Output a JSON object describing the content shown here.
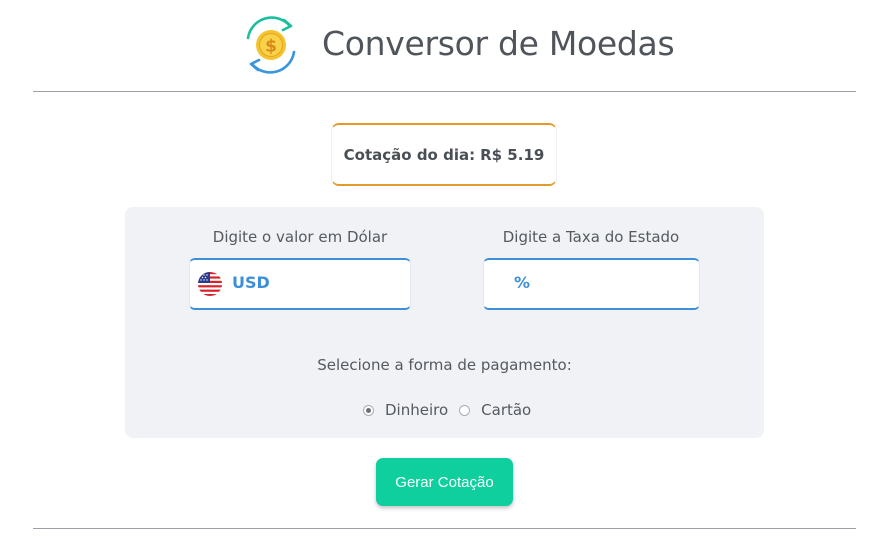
{
  "header": {
    "title": "Conversor de Moedas",
    "logo_icon": "dollar-coin-exchange-icon"
  },
  "rate": {
    "label": "Cotação do dia:",
    "value": "R$ 5.19"
  },
  "form": {
    "usd_label": "Digite o valor em Dólar",
    "usd_prefix": "USD",
    "usd_value": "",
    "tax_label": "Digite a Taxa do Estado",
    "tax_prefix": "%",
    "tax_value": "",
    "payment_label": "Selecione a forma de pagamento:",
    "payment_options": [
      {
        "label": "Dinheiro",
        "checked": true
      },
      {
        "label": "Cartão",
        "checked": false
      }
    ],
    "submit_label": "Gerar Cotação"
  },
  "colors": {
    "accent_blue": "#3d8fd8",
    "accent_orange": "#e39a2b",
    "button_green": "#0fcf9e",
    "panel_bg": "#f0f2f5"
  }
}
